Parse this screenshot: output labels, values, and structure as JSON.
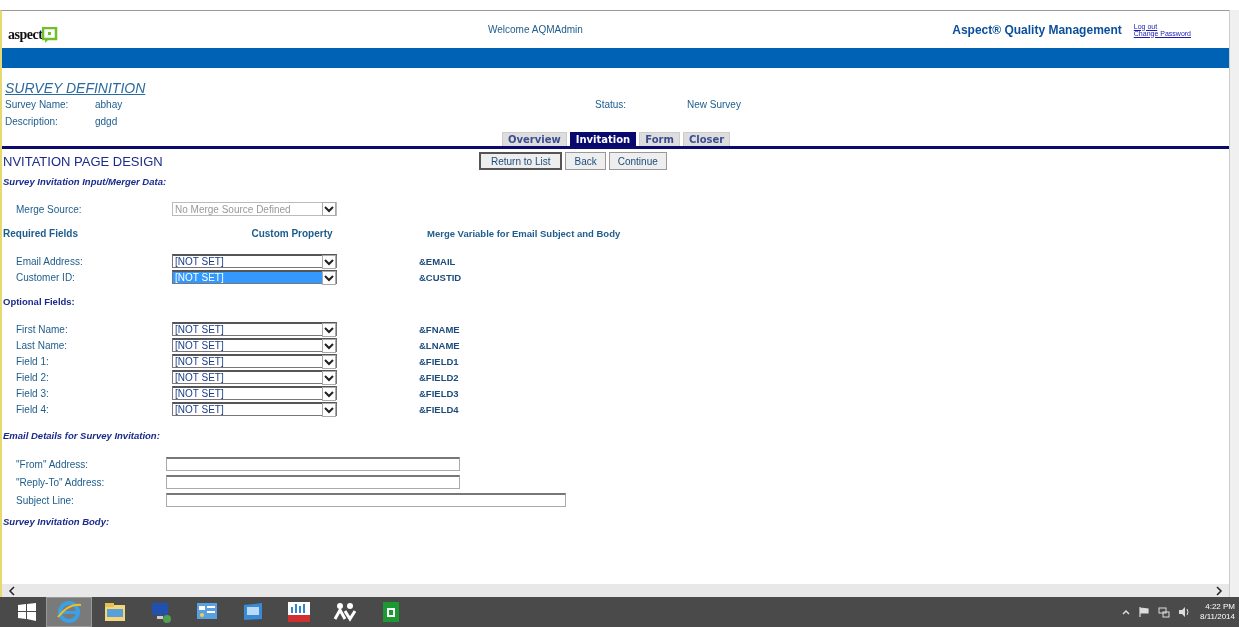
{
  "header": {
    "logo": "aspect",
    "welcome": "Welcome AQMAdmin",
    "product": "Aspect® Quality Management",
    "links": [
      "Log out",
      "Change Password"
    ]
  },
  "survey": {
    "title": "SURVEY DEFINITION",
    "fields": [
      {
        "label": "Survey Name:",
        "value": "abhay"
      },
      {
        "label": "Description:",
        "value": "gdgd"
      }
    ],
    "status": {
      "label": "Status:",
      "value": "New Survey"
    }
  },
  "tabs": [
    {
      "label": "Overview",
      "selected": false
    },
    {
      "label": "Invitation",
      "selected": true
    },
    {
      "label": "Form",
      "selected": false
    },
    {
      "label": "Closer",
      "selected": false
    }
  ],
  "page_title": "NVITATION PAGE DESIGN",
  "buttons": [
    "Return to List",
    "Back",
    "Continue"
  ],
  "input_heading": "Survey Invitation Input/Merger Data:",
  "merge_source": {
    "label": "Merge Source:",
    "value": "No Merge Source Defined",
    "disabled": true
  },
  "required": {
    "heading": "Required Fields",
    "columns": [
      "Custom Property",
      "Merge Variable for Email Subject and Body"
    ],
    "rows": [
      {
        "label": "Email Address:",
        "value": "[NOT SET]",
        "variable": "&EMAIL",
        "selected": false
      },
      {
        "label": "Customer ID:",
        "value": "[NOT SET]",
        "variable": "&CUSTID",
        "selected": true
      }
    ]
  },
  "optional": {
    "heading": "Optional Fields:",
    "rows": [
      {
        "label": "First Name:",
        "value": "[NOT SET]",
        "variable": "&FNAME",
        "selected": false
      },
      {
        "label": "Last Name:",
        "value": "[NOT SET]",
        "variable": "&LNAME",
        "selected": false
      },
      {
        "label": "Field 1:",
        "value": "[NOT SET]",
        "variable": "&FIELD1",
        "selected": false
      },
      {
        "label": "Field 2:",
        "value": "[NOT SET]",
        "variable": "&FIELD2",
        "selected": false
      },
      {
        "label": "Field 3:",
        "value": "[NOT SET]",
        "variable": "&FIELD3",
        "selected": false
      },
      {
        "label": "Field 4:",
        "value": "[NOT SET]",
        "variable": "&FIELD4",
        "selected": false
      }
    ]
  },
  "email": {
    "heading": "Email Details for Survey Invitation:",
    "fields": [
      {
        "label": "\"From\" Address:"
      },
      {
        "label": "\"Reply-To\" Address:"
      },
      {
        "label": "Subject Line:"
      }
    ]
  },
  "body_heading": "Survey Invitation Body:",
  "taskbar": {
    "apps": [
      {
        "kind": "browser",
        "selected": true
      },
      {
        "kind": "folder",
        "selected": false
      },
      {
        "kind": "computer",
        "selected": false
      },
      {
        "kind": "panel",
        "selected": false
      },
      {
        "kind": "window",
        "selected": false
      },
      {
        "kind": "bars",
        "selected": false
      },
      {
        "kind": "people",
        "selected": false
      },
      {
        "kind": "store",
        "selected": false
      }
    ],
    "time": "4:22 PM",
    "date": "8/11/2014"
  }
}
